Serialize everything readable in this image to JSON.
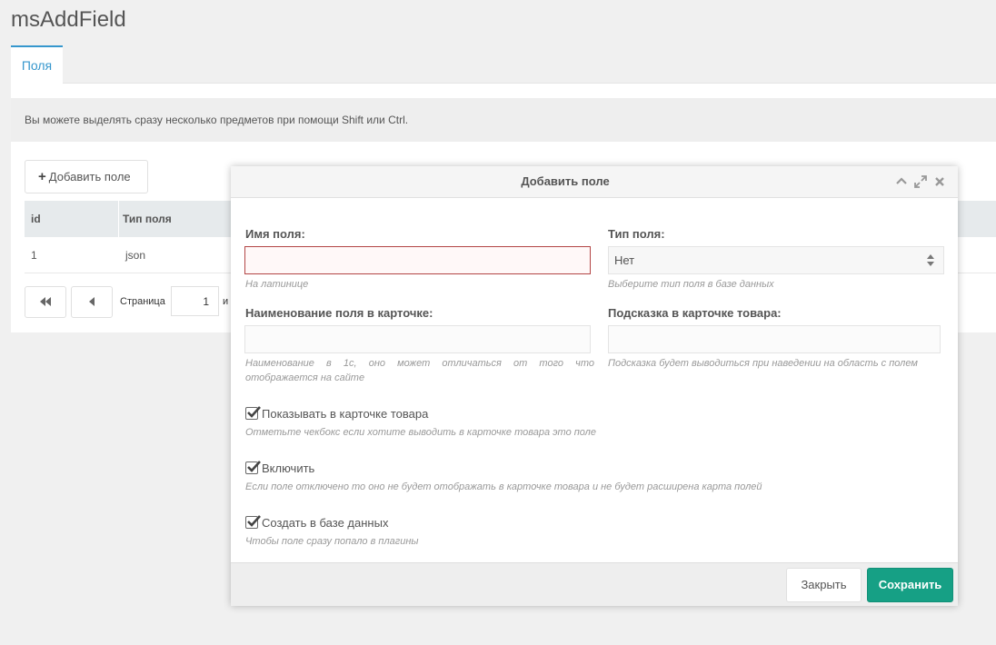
{
  "app": {
    "title": "msAddField"
  },
  "tabs": [
    {
      "label": "Поля"
    }
  ],
  "info_text": "Вы можете выделять сразу несколько предметов при помощи Shift или Ctrl.",
  "toolbar": {
    "add_label": "Добавить поле",
    "add_icon": "plus-icon"
  },
  "grid": {
    "columns": [
      {
        "label": "id"
      },
      {
        "label": "Тип поля"
      }
    ],
    "rows": [
      {
        "id": "1",
        "type": "json"
      }
    ]
  },
  "pager": {
    "page_label": "Страница",
    "page_value": "1",
    "of_label": "и"
  },
  "modal": {
    "title": "Добавить поле",
    "fields": {
      "name": {
        "label": "Имя поля:",
        "value": "",
        "hint": "На латинице"
      },
      "type": {
        "label": "Тип поля:",
        "selected": "Нет",
        "hint": "Выберите тип поля в базе данных"
      },
      "caption": {
        "label": "Наименование поля в карточке:",
        "value": "",
        "hint": "Наименование в 1с, оно может отличаться от того что отображается на сайте"
      },
      "tooltip": {
        "label": "Подсказка в карточке товара:",
        "value": "",
        "hint": "Подсказка будет выводиться при наведении на область с полем"
      }
    },
    "checkboxes": [
      {
        "label": "Показывать в карточке товара",
        "checked": true,
        "hint": "Отметьте чекбокс если хотите выводить в карточке товара это поле"
      },
      {
        "label": "Включить",
        "checked": true,
        "hint": "Если поле отключено то оно не будет отображать в карточке товара и не будет расширена карта полей"
      },
      {
        "label": "Создать в базе данных",
        "checked": true,
        "hint": "Чтобы поле сразу попало в плагины"
      }
    ],
    "buttons": {
      "close": "Закрыть",
      "save": "Сохранить"
    }
  },
  "colors": {
    "accent": "#3697cd",
    "save": "#16a085",
    "error_border": "#b34545"
  }
}
